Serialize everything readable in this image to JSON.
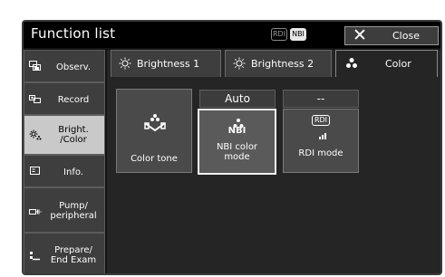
{
  "titlebar": {
    "title": "Function list",
    "badge_rdi": "RDI",
    "badge_nbi": "NBI",
    "close_label": "Close"
  },
  "sidebar": {
    "items": [
      {
        "label": "Observ.",
        "icon": "observation-icon"
      },
      {
        "label": "Record",
        "icon": "record-icon"
      },
      {
        "label": "Bright.\n/Color",
        "icon": "brightness-color-icon",
        "selected": true
      },
      {
        "label": "Info.",
        "icon": "info-icon"
      },
      {
        "label": "Pump/\nperipheral",
        "icon": "pump-icon"
      },
      {
        "label": "Prepare/\nEnd Exam",
        "icon": "prepare-icon"
      }
    ]
  },
  "tabs": [
    {
      "label": "Brightness 1",
      "icon": "sun-icon"
    },
    {
      "label": "Brightness 2",
      "icon": "sun-icon"
    },
    {
      "label": "Color",
      "icon": "color-dots-icon",
      "active": true
    }
  ],
  "color_functions": [
    {
      "header": "",
      "label": "Color tone",
      "icon": "color-tone-icon"
    },
    {
      "header": "Auto",
      "label": "NBI color\nmode",
      "icon_text": "NBI",
      "icon": "nbi-icon",
      "selected": true
    },
    {
      "header": "--",
      "label": "RDI mode",
      "icon_text": "RDI",
      "icon": "rdi-icon"
    }
  ],
  "colors": {
    "window_bg": "#131313",
    "content_bg": "#252525",
    "button_bg": "#4a4a4a",
    "selected_sidebar": "#c9c9c9"
  }
}
